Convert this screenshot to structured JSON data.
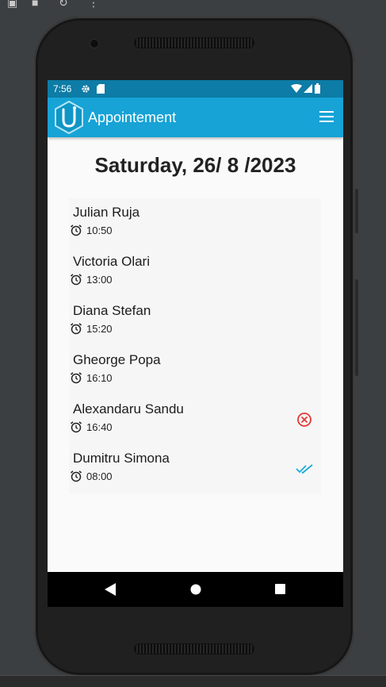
{
  "status_bar": {
    "time": "7:56"
  },
  "app_bar": {
    "title": "Appointement"
  },
  "date_heading": "Saturday, 26/ 8 /2023",
  "appointments": [
    {
      "name": "Julian Ruja",
      "time": "10:50",
      "status": "none"
    },
    {
      "name": "Victoria Olari",
      "time": "13:00",
      "status": "none"
    },
    {
      "name": "Diana Stefan",
      "time": "15:20",
      "status": "none"
    },
    {
      "name": "Gheorge Popa",
      "time": "16:10",
      "status": "none"
    },
    {
      "name": "Alexandaru Sandu",
      "time": "16:40",
      "status": "cancelled"
    },
    {
      "name": "Dumitru Simona",
      "time": "08:00",
      "status": "confirmed"
    }
  ],
  "colors": {
    "status_bar": "#0d7ca6",
    "app_bar": "#17a3d6",
    "cancel_icon": "#e53935",
    "confirm_icon": "#1eaad6"
  },
  "icons": {
    "emulator_toolbar": [
      "camera-icon",
      "video-icon",
      "rotate-icon",
      "more-icon"
    ],
    "status_bar": [
      "gear-icon",
      "sd-card-icon",
      "wifi-icon",
      "signal-icon",
      "battery-icon"
    ],
    "app_bar": [
      "app-logo-icon",
      "hamburger-menu-icon"
    ],
    "list": [
      "alarm-clock-icon",
      "cancel-circle-icon",
      "double-check-icon"
    ],
    "nav_bar": [
      "back-icon",
      "home-icon",
      "recents-icon"
    ]
  }
}
